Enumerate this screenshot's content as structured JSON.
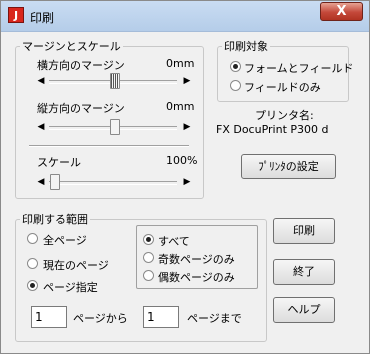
{
  "window": {
    "title": "印刷",
    "icon_letter": "J",
    "close_label": "X"
  },
  "margin_group": {
    "legend": "マージンとスケール",
    "horizontal": {
      "label": "横方向のマージン",
      "value": "0mm"
    },
    "vertical": {
      "label": "縦方向のマージン",
      "value": "0mm"
    },
    "scale": {
      "label": "スケール",
      "value": "100%"
    }
  },
  "print_target": {
    "legend": "印刷対象",
    "options": [
      {
        "label": "フォームとフィールド",
        "selected": true
      },
      {
        "label": "フィールドのみ",
        "selected": false
      }
    ]
  },
  "printer": {
    "name_label": "プリンタ名:",
    "name_value": "FX DocuPrint P300 d",
    "settings_button": "ﾌﾟﾘﾝﾀの設定"
  },
  "range_group": {
    "legend": "印刷する範囲",
    "options": [
      {
        "label": "全ページ",
        "selected": false
      },
      {
        "label": "現在のページ",
        "selected": false
      },
      {
        "label": "ページ指定",
        "selected": true
      }
    ],
    "page_options": [
      {
        "label": "すべて",
        "selected": true
      },
      {
        "label": "奇数ページのみ",
        "selected": false
      },
      {
        "label": "偶数ページのみ",
        "selected": false
      }
    ],
    "from_value": "1",
    "from_label": "ページから",
    "to_value": "1",
    "to_label": "ページまで"
  },
  "buttons": {
    "print": "印刷",
    "exit": "終了",
    "help": "ヘルプ"
  }
}
